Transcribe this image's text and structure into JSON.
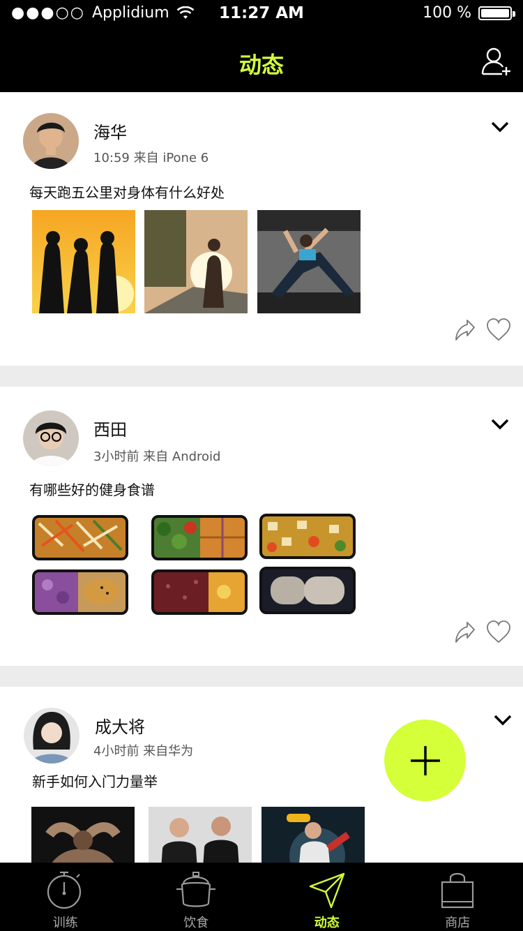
{
  "status": {
    "carrier": "Applidium",
    "signal_dots": "●●●○○",
    "time": "11:27 AM",
    "battery_text": "100 %",
    "battery_level": 1.0
  },
  "header": {
    "title": "动态",
    "add_user_icon": "add-user-icon",
    "accent": "#d4ff39"
  },
  "posts": [
    {
      "name": "海华",
      "meta": "10:59  来自 iPone 6",
      "caption": "每天跑五公里对身体有什么好处"
    },
    {
      "name": "西田",
      "meta": "3小时前 来自 Android",
      "caption": "有哪些好的健身食谱"
    },
    {
      "name": "成大将",
      "meta": "4小时前 来自华为",
      "caption": "新手如何入门力量举"
    }
  ],
  "tabs": [
    {
      "label": "训练",
      "icon": "stopwatch-icon"
    },
    {
      "label": "饮食",
      "icon": "pot-icon"
    },
    {
      "label": "动态",
      "icon": "paper-plane-icon",
      "active": true
    },
    {
      "label": "商店",
      "icon": "shopping-bag-icon"
    }
  ]
}
